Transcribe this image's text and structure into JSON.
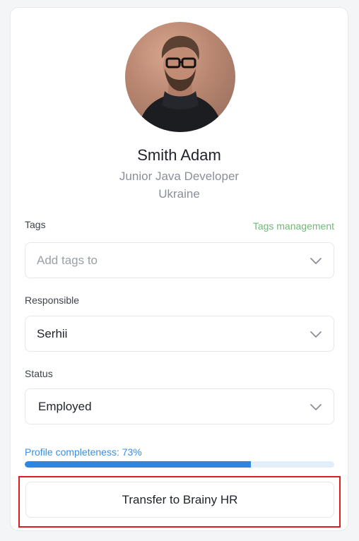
{
  "profile": {
    "name": "Smith Adam",
    "role": "Junior Java Developer",
    "country": "Ukraine"
  },
  "tags": {
    "label": "Tags",
    "management_link": "Tags management",
    "placeholder": "Add tags to"
  },
  "responsible": {
    "label": "Responsible",
    "value": "Serhii"
  },
  "status": {
    "label": "Status",
    "value": "Employed"
  },
  "completeness": {
    "label": "Profile completeness: 73%",
    "percent": 73
  },
  "actions": {
    "transfer_label": "Transfer to Brainy HR"
  },
  "colors": {
    "accent_blue": "#2d87e2",
    "link_green": "#71b77a",
    "highlight_red": "#d81e1e"
  }
}
